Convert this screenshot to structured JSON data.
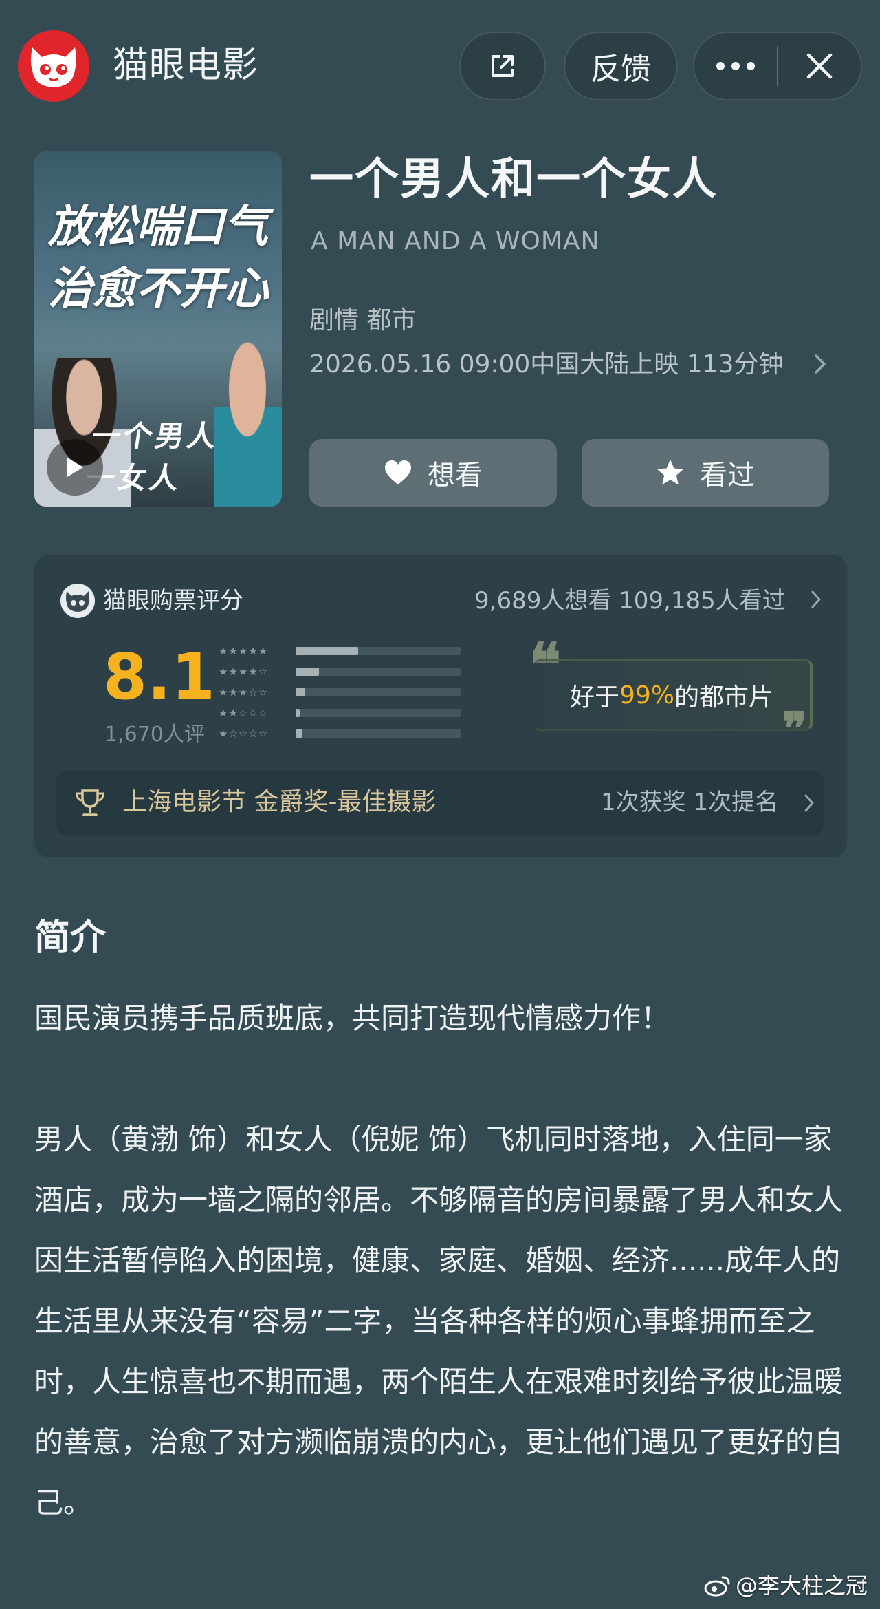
{
  "header": {
    "app_name": "猫眼电影",
    "feedback_label": "反馈"
  },
  "movie": {
    "poster_line1": "放松喘口气",
    "poster_line2": "治愈不开心",
    "poster_logo": "一个男人一女人",
    "title": "一个男人和一个女人",
    "english_title": "A MAN AND A WOMAN",
    "genres": "剧情 都市",
    "release": "2026.05.16 09:00中国大陆上映 113分钟",
    "want_label": "想看",
    "seen_label": "看过"
  },
  "rating": {
    "label": "猫眼购票评分",
    "counts": "9,689人想看 109,185人看过",
    "score": "8.1",
    "rating_count": "1,670人评",
    "distribution": [
      {
        "stars": 5,
        "fraction": 0.38
      },
      {
        "stars": 4,
        "fraction": 0.14
      },
      {
        "stars": 3,
        "fraction": 0.06
      },
      {
        "stars": 2,
        "fraction": 0.02
      },
      {
        "stars": 1,
        "fraction": 0.04
      }
    ],
    "compare_prefix": "好于",
    "compare_pct": "99%",
    "compare_suffix": "的都市片",
    "quote_open": "❝",
    "quote_close": "❞"
  },
  "award": {
    "name": "上海电影节 金爵奖-最佳摄影",
    "stats": "1次获奖 1次提名"
  },
  "synopsis": {
    "title": "简介",
    "p1": "国民演员携手品质班底，共同打造现代情感力作！",
    "p2": "男人（黄渤 饰）和女人（倪妮 饰）飞机同时落地，入住同一家酒店，成为一墙之隔的邻居。不够隔音的房间暴露了男人和女人因生活暂停陷入的困境，健康、家庭、婚姻、经济......成年人的生活里从来没有“容易”二字，当各种各样的烦心事蜂拥而至之时，人生惊喜也不期而遇，两个陌生人在艰难时刻给予彼此温暖的善意，治愈了对方濒临崩溃的内心，更让他们遇见了更好的自己。"
  },
  "watermark": "@李大柱之冠",
  "colors": {
    "background": "#354b53",
    "brand_red": "#e1262b",
    "score_gold": "#f5b21e",
    "award_text": "#d9c79c"
  },
  "icons": [
    "cat-logo-icon",
    "share-icon",
    "more-icon",
    "close-icon",
    "play-icon",
    "heart-icon",
    "star-icon",
    "chevron-right-icon",
    "cat-rating-icon",
    "trophy-icon",
    "weibo-icon"
  ]
}
